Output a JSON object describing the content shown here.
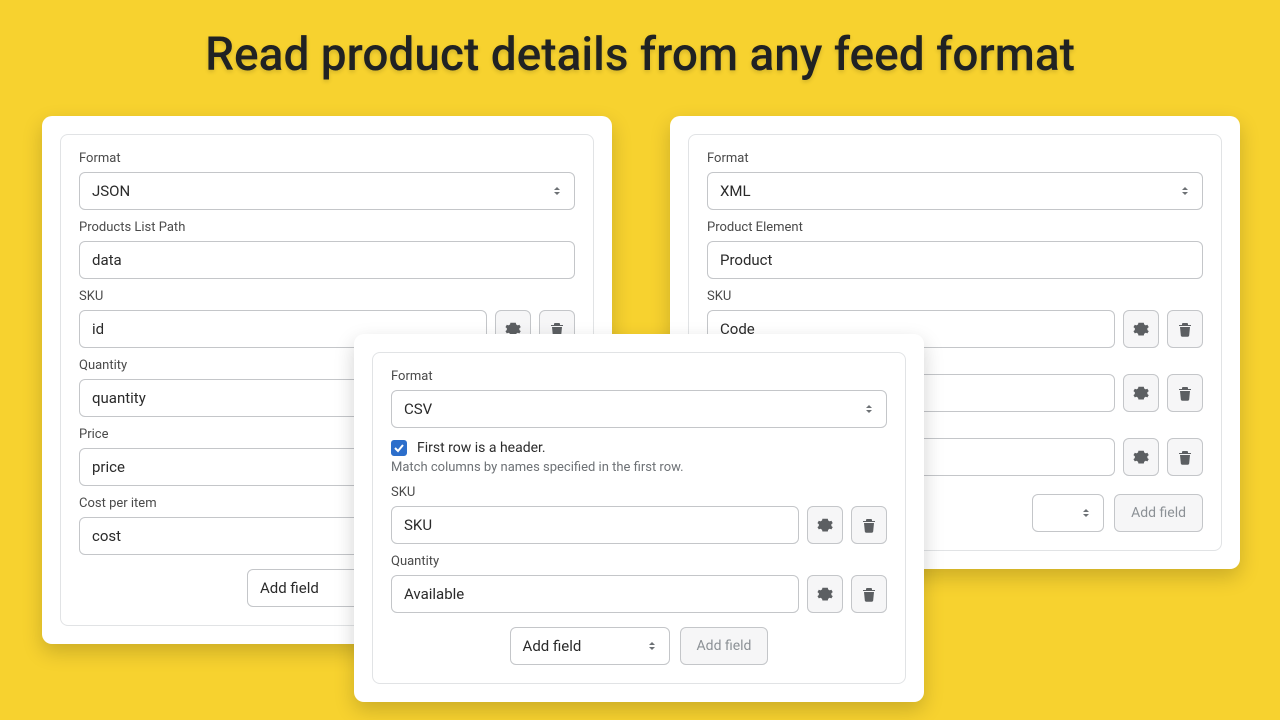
{
  "headline": "Read product details from any feed format",
  "json_card": {
    "format_label": "Format",
    "format_value": "JSON",
    "listpath_label": "Products List Path",
    "listpath_value": "data",
    "sku_label": "SKU",
    "sku_value": "id",
    "qty_label": "Quantity",
    "qty_value": "quantity",
    "price_label": "Price",
    "price_value": "price",
    "cost_label": "Cost per item",
    "cost_value": "cost",
    "addfield_select": "Add field"
  },
  "xml_card": {
    "format_label": "Format",
    "format_value": "XML",
    "elem_label": "Product Element",
    "elem_value": "Product",
    "sku_label": "SKU",
    "sku_value": "Code",
    "addfield_btn": "Add field"
  },
  "csv_card": {
    "format_label": "Format",
    "format_value": "CSV",
    "header_checkbox_checked": true,
    "header_checkbox_label": "First row is a header.",
    "header_helper": "Match columns by names specified in the first row.",
    "sku_label": "SKU",
    "sku_value": "SKU",
    "qty_label": "Quantity",
    "qty_value": "Available",
    "addfield_select": "Add field",
    "addfield_btn": "Add field"
  }
}
